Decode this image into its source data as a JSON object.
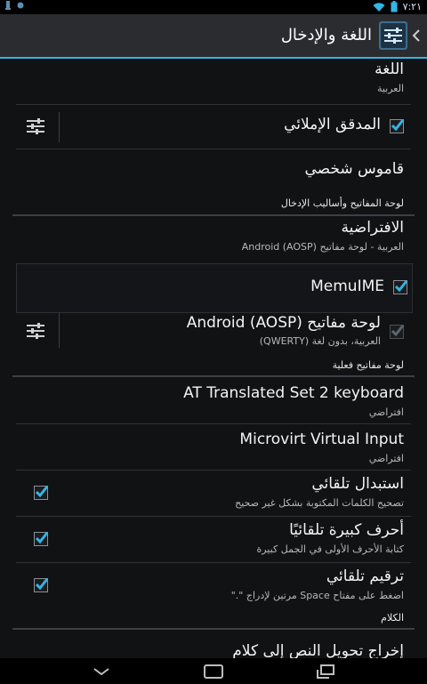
{
  "status_bar": {
    "time": "٧:٢١"
  },
  "action_bar": {
    "title": "اللغة والإدخال",
    "icon": "settings-sliders-icon"
  },
  "items": {
    "language": {
      "title": "اللغة",
      "summary": "العربية"
    },
    "spell_checker": {
      "title": "المدقق الإملائي",
      "checked": true
    },
    "personal_dictionary": {
      "title": "قاموس شخصي"
    },
    "category_keyboard": "لوحة المفاتيح وأساليب الإدخال",
    "default": {
      "title": "الافتراضية",
      "summary": "العربية - لوحة مفاتيح Android (AOSP)"
    },
    "memuime": {
      "title": "MemuIME",
      "checked": true
    },
    "aosp_keyboard": {
      "title": "لوحة مفاتيح Android (AOSP)",
      "summary": "العربية، بدون لغة (QWERTY)",
      "checked": true
    },
    "category_physical": "لوحة مفاتيح فعلية",
    "at_keyboard": {
      "title": "AT Translated Set 2 keyboard",
      "summary": "افتراضي"
    },
    "microvirt": {
      "title": "Microvirt Virtual Input",
      "summary": "افتراضي"
    },
    "auto_replace": {
      "title": "استبدال تلقائي",
      "summary": "تصحيح الكلمات المكتوبة بشكل غير صحيح",
      "checked": true
    },
    "auto_caps": {
      "title": "أحرف كبيرة تلقائيًا",
      "summary": "كتابة الأحرف الأولى في الجمل كبيرة",
      "checked": true
    },
    "auto_punct": {
      "title": "ترقيم تلقائي",
      "summary": "اضغط على مفتاح Space مرتين لإدراج \".\"",
      "checked": true
    },
    "category_speech": "الكلام",
    "tts_output": {
      "title": "إخراج تحويل النص إلى كلام"
    }
  },
  "colors": {
    "accent": "#33b5e5",
    "background": "#111214",
    "actionbar": "#2a2c30"
  }
}
